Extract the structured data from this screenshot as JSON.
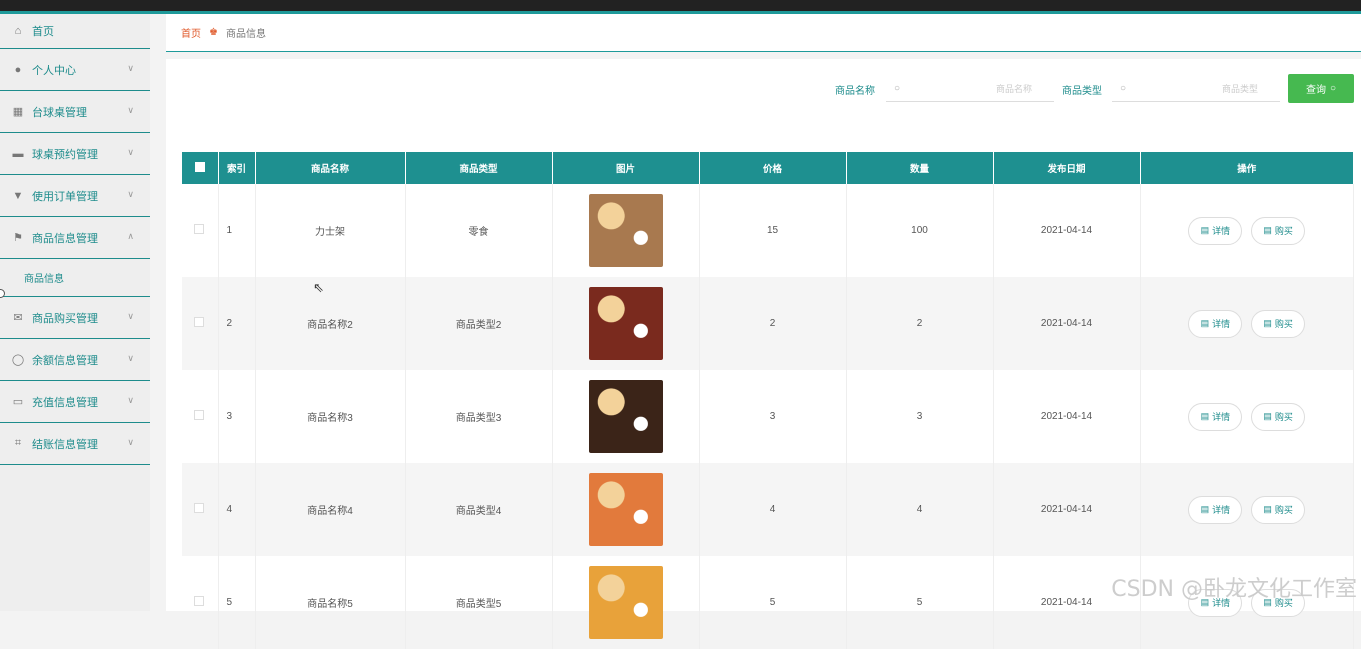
{
  "sidebar": {
    "home": "首页",
    "items": [
      {
        "label": "个人中心",
        "icon": "user-icon"
      },
      {
        "label": "台球桌管理",
        "icon": "grid-icon"
      },
      {
        "label": "球桌预约管理",
        "icon": "box-icon"
      },
      {
        "label": "使用订单管理",
        "icon": "bookmark-icon"
      },
      {
        "label": "商品信息管理",
        "icon": "flag-icon"
      },
      {
        "label": "商品购买管理",
        "icon": "mail-icon"
      },
      {
        "label": "余额信息管理",
        "icon": "power-icon"
      },
      {
        "label": "充值信息管理",
        "icon": "message-icon"
      },
      {
        "label": "结账信息管理",
        "icon": "crop-icon"
      }
    ],
    "submenu": "商品信息"
  },
  "breadcrumb": {
    "home": "首页",
    "current": "商品信息"
  },
  "search": {
    "name_label": "商品名称",
    "name_placeholder": "商品名称",
    "type_label": "商品类型",
    "type_placeholder": "商品类型",
    "query_button": "查询"
  },
  "table": {
    "headers": [
      "索引",
      "商品名称",
      "商品类型",
      "图片",
      "价格",
      "数量",
      "发布日期",
      "操作"
    ],
    "rows": [
      {
        "index": "1",
        "name": "力士架",
        "type": "零食",
        "price": "15",
        "qty": "100",
        "date": "2021-04-14",
        "image_color": "#a8794f"
      },
      {
        "index": "2",
        "name": "商品名称2",
        "type": "商品类型2",
        "price": "2",
        "qty": "2",
        "date": "2021-04-14",
        "image_color": "#7a2a1e"
      },
      {
        "index": "3",
        "name": "商品名称3",
        "type": "商品类型3",
        "price": "3",
        "qty": "3",
        "date": "2021-04-14",
        "image_color": "#3b2418"
      },
      {
        "index": "4",
        "name": "商品名称4",
        "type": "商品类型4",
        "price": "4",
        "qty": "4",
        "date": "2021-04-14",
        "image_color": "#e27a3c"
      },
      {
        "index": "5",
        "name": "商品名称5",
        "type": "商品类型5",
        "price": "5",
        "qty": "5",
        "date": "2021-04-14",
        "image_color": "#e8a23a"
      }
    ],
    "detail_label": "详情",
    "buy_label": "购买"
  },
  "watermark": "CSDN @卧龙文化工作室",
  "colors": {
    "accent": "#1e9090",
    "query": "#46b950",
    "breadcrumb_home": "#e05a2b"
  }
}
